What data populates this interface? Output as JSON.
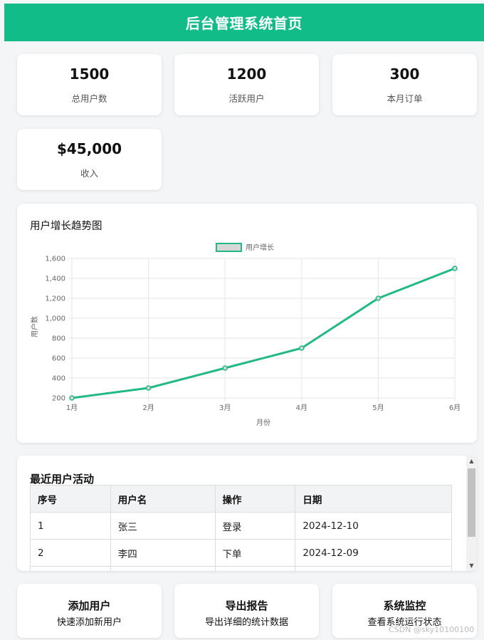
{
  "header": {
    "title": "后台管理系统首页"
  },
  "stats": [
    {
      "value": "1500",
      "label": "总用户数"
    },
    {
      "value": "1200",
      "label": "活跃用户"
    },
    {
      "value": "300",
      "label": "本月订单"
    },
    {
      "value": "$45,000",
      "label": "收入"
    }
  ],
  "chart": {
    "title": "用户增长趋势图"
  },
  "chart_data": {
    "type": "line",
    "categories": [
      "1月",
      "2月",
      "3月",
      "4月",
      "5月",
      "6月"
    ],
    "series": [
      {
        "name": "用户增长",
        "values": [
          200,
          300,
          500,
          700,
          1200,
          1500
        ]
      }
    ],
    "xlabel": "月份",
    "ylabel": "用户数",
    "ylim": [
      200,
      1600
    ],
    "yticks": [
      200,
      400,
      600,
      800,
      1000,
      1200,
      1400,
      1600
    ],
    "ytick_labels": [
      "200",
      "400",
      "600",
      "800",
      "1,000",
      "1,200",
      "1,400",
      "1,600"
    ],
    "grid": true,
    "legend": "top",
    "color": "#22b987"
  },
  "activity": {
    "title": "最近用户活动",
    "columns": [
      "序号",
      "用户名",
      "操作",
      "日期"
    ],
    "rows": [
      [
        "1",
        "张三",
        "登录",
        "2024-12-10"
      ],
      [
        "2",
        "李四",
        "下单",
        "2024-12-09"
      ]
    ]
  },
  "actions": [
    {
      "title": "添加用户",
      "desc": "快速添加新用户"
    },
    {
      "title": "导出报告",
      "desc": "导出详细的统计数据"
    },
    {
      "title": "系统监控",
      "desc": "查看系统运行状态"
    }
  ],
  "watermark": "CSDN @sky10100100"
}
